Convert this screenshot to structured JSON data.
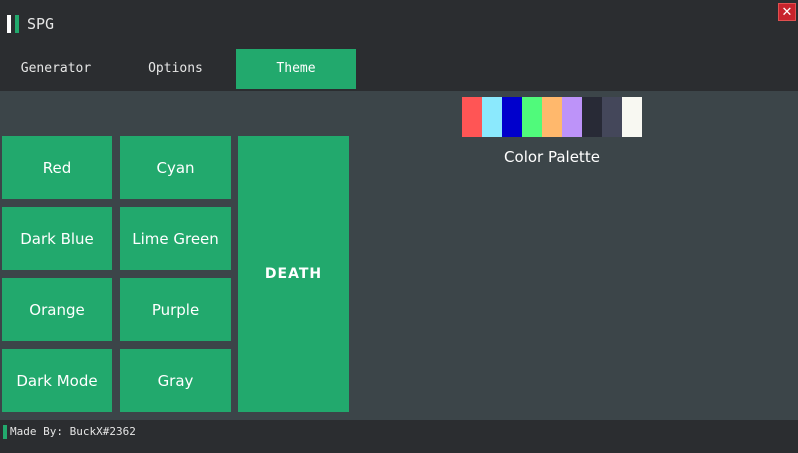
{
  "app": {
    "title": "SPG",
    "close_glyph": "✕"
  },
  "tabs": [
    {
      "label": "Generator",
      "active": false
    },
    {
      "label": "Options",
      "active": false
    },
    {
      "label": "Theme",
      "active": true
    }
  ],
  "theme_buttons": {
    "red": "Red",
    "cyan": "Cyan",
    "dark_blue": "Dark Blue",
    "lime_green": "Lime Green",
    "orange": "Orange",
    "purple": "Purple",
    "dark_mode": "Dark Mode",
    "gray": "Gray",
    "death": "DEATH"
  },
  "palette": {
    "label": "Color Palette",
    "colors": [
      "#ff5555",
      "#8be9fd",
      "#0000cc",
      "#50fa7b",
      "#ffb86c",
      "#bd93f9",
      "#282a36",
      "#44475a",
      "#f8f8f2"
    ]
  },
  "footer": {
    "text": "Made By: BuckX#2362"
  },
  "colors": {
    "accent": "#22a96d",
    "bar_bg": "#2b2d30",
    "content_bg": "#3c4549",
    "close": "#c8232c"
  }
}
